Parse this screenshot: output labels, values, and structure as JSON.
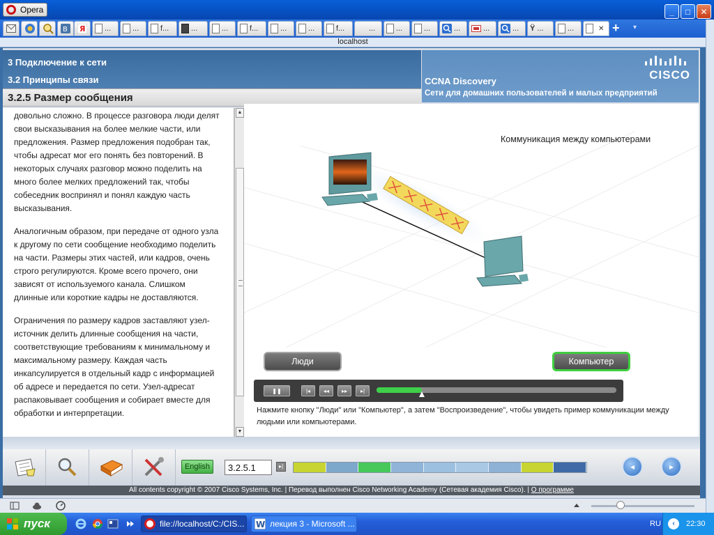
{
  "browser": {
    "app_name": "Opera",
    "window_buttons": [
      "_",
      "□",
      "✕"
    ],
    "address": "localhost",
    "tabs": [
      {
        "icon": "mail-icon",
        "label": "",
        "small": true
      },
      {
        "icon": "opera-unite-icon",
        "label": "",
        "small": true
      },
      {
        "icon": "search-icon",
        "label": "",
        "small": true
      },
      {
        "icon": "vk-icon",
        "label": "",
        "small": true
      },
      {
        "icon": "yandex-icon",
        "label": "",
        "small": true
      },
      {
        "icon": "page-icon",
        "label": "..."
      },
      {
        "icon": "page-icon",
        "label": "..."
      },
      {
        "icon": "page-icon",
        "label": "f..."
      },
      {
        "icon": "download-icon",
        "label": "..."
      },
      {
        "icon": "page-icon",
        "label": "..."
      },
      {
        "icon": "page-icon",
        "label": "f..."
      },
      {
        "icon": "page-icon",
        "label": "..."
      },
      {
        "icon": "page-icon",
        "label": "..."
      },
      {
        "icon": "page-icon",
        "label": "f..."
      },
      {
        "icon": "blank-icon",
        "label": "..."
      },
      {
        "icon": "page-icon",
        "label": "..."
      },
      {
        "icon": "page-icon",
        "label": "..."
      },
      {
        "icon": "search-icon",
        "label": "..."
      },
      {
        "icon": "video-icon",
        "label": "..."
      },
      {
        "icon": "search-icon",
        "label": "..."
      },
      {
        "icon": "yandex-v-icon",
        "label": "..."
      },
      {
        "icon": "page-icon",
        "label": "..."
      },
      {
        "icon": "page-icon",
        "label": "",
        "active": true,
        "close": "✕"
      }
    ],
    "new_tab": "+",
    "tab_menu": "▾"
  },
  "course": {
    "chapter": "3 Подключение к сети",
    "subchapter": "3.2 Принципы связи",
    "section": "3.2.5 Размер сообщения",
    "brand_logo": "CISCO",
    "program": "CCNA Discovery",
    "program_subtitle": "Сети для домашних пользователей и малых предприятий",
    "paragraphs": [
      "довольно сложно. В процессе разговора люди делят свои высказывания на более мелкие части, или предложения. Размер предложения подобран так, чтобы адресат мог его понять без повторений. В некоторых случаях разговор можно поделить на много более мелких предложений так, чтобы собеседник воспринял и понял каждую часть высказывания.",
      "Аналогичным образом, при передаче от одного узла к другому по сети сообщение необходимо поделить на части. Размеры этих частей, или кадров, очень строго регулируются. Кроме всего прочего, они зависят от используемого канала. Слишком длинные или короткие кадры не доставляются.",
      "Ограничения по размеру кадров заставляют узел-источник делить длинные сообщения на части, соответствующие требованиям к минимальному и максимальному размеру. Каждая часть инкапсулируется в отдельный кадр с информацией об адресе и передается по сети. Узел-адресат распаковывает сообщения и собирает вместе для обработки и интерпретации."
    ],
    "scroll_up": "▲",
    "scroll_down": "▼",
    "animation": {
      "title": "Коммуникация между компьютерами",
      "people_button": "Люди",
      "computer_button": "Компьютер",
      "controls": [
        "❚❚",
        "|◂",
        "◂◂",
        "▸▸",
        "▸|"
      ],
      "progress": 0.19,
      "instruction": "Нажмите кнопку \"Люди\" или \"Компьютер\", а затем \"Воспроизведение\", чтобы увидеть пример коммуникации между людьми или компьютерами."
    },
    "toolbar": {
      "tools": [
        "glossary-icon",
        "search-icon",
        "book-icon",
        "tools-icon"
      ],
      "language_button": "English",
      "page_number": "3.2.5.1",
      "go": "▸|",
      "prev": "◂",
      "next": "▸"
    },
    "progress_segments": [
      "#c8d432",
      "#7ea7cc",
      "#46c85a",
      "#8fb4d8",
      "#9cc0e0",
      "#a8c8e4",
      "#8eb2d6",
      "#c8d432",
      "#3f6aa6"
    ],
    "footer_text": "All contents copyright © 2007 Cisco Systems, Inc. | Перевод выполнен Cisco Networking Academy (Сетевая академия Cisco). |",
    "footer_link": "О программе"
  },
  "taskbar": {
    "start": "пуск",
    "tasks": [
      "file://localhost/C:/CIS...",
      "лекция 3 - Microsoft ..."
    ],
    "lang": "RU",
    "time": "22:30"
  }
}
